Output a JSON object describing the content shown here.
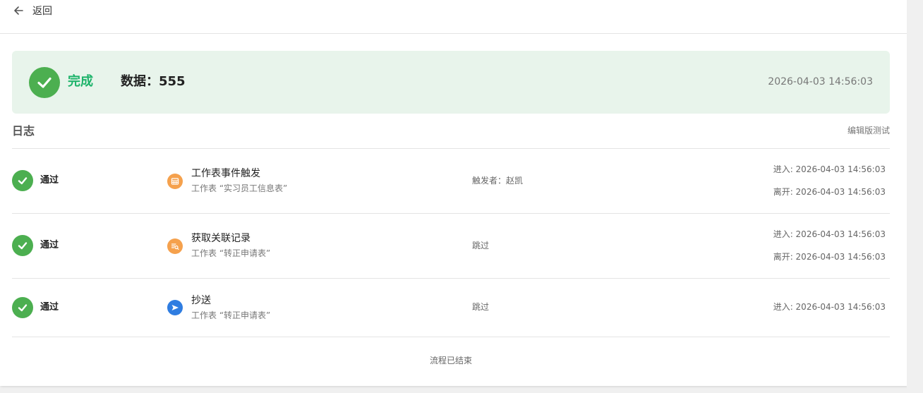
{
  "header": {
    "back_label": "返回"
  },
  "banner": {
    "status": "完成",
    "data_text": "数据：555",
    "time": "2026-04-03 14:56:03",
    "color": "#4caf50",
    "background": "#e8f4eb"
  },
  "log": {
    "title": "日志",
    "edit_label": "编辑版测试",
    "rows": [
      {
        "status": "通过",
        "icon": "table-icon",
        "icon_color": "#f5a14d",
        "name": "工作表事件触发",
        "sub": "工作表 “实习员工信息表”",
        "mid": "触发者：赵凯",
        "enter": "进入: 2026-04-03 14:56:03",
        "leave": "离开: 2026-04-03 14:56:03"
      },
      {
        "status": "通过",
        "icon": "record-search-icon",
        "icon_color": "#f5a14d",
        "name": "获取关联记录",
        "sub": "工作表 “转正申请表”",
        "mid": "跳过",
        "enter": "进入: 2026-04-03 14:56:03",
        "leave": "离开: 2026-04-03 14:56:03"
      },
      {
        "status": "通过",
        "icon": "send-icon",
        "icon_color": "#2f7de1",
        "name": "抄送",
        "sub": "工作表 “转正申请表”",
        "mid": "跳过",
        "enter": "进入: 2026-04-03 14:56:03"
      }
    ]
  },
  "footer": {
    "text": "流程已结束"
  }
}
